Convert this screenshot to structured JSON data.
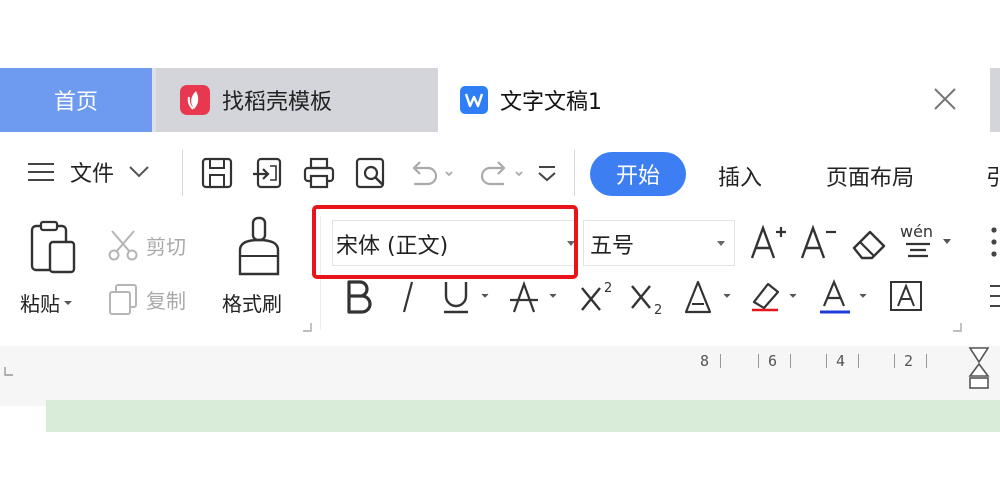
{
  "tabs": {
    "home": "首页",
    "daoke": "找稻壳模板",
    "doc": "文字文稿1"
  },
  "menu": {
    "file": "文件"
  },
  "ribbon_tabs": {
    "start": "开始",
    "insert": "插入",
    "layout": "页面布局",
    "partial": "引"
  },
  "clipboard": {
    "paste": "粘贴",
    "cut": "剪切",
    "copy": "复制",
    "format_painter": "格式刷"
  },
  "font": {
    "name": "宋体 (正文)",
    "size": "五号",
    "phonetic": "wén"
  },
  "ruler": {
    "ticks": [
      "8",
      "6",
      "4",
      "2"
    ]
  },
  "colors": {
    "home_tab": "#6e9bf0",
    "start_button": "#3d7ff2",
    "highlight_border": "#e8141a",
    "font_color_underline": "#1f3bd6",
    "green_band": "#d9ebd9"
  }
}
